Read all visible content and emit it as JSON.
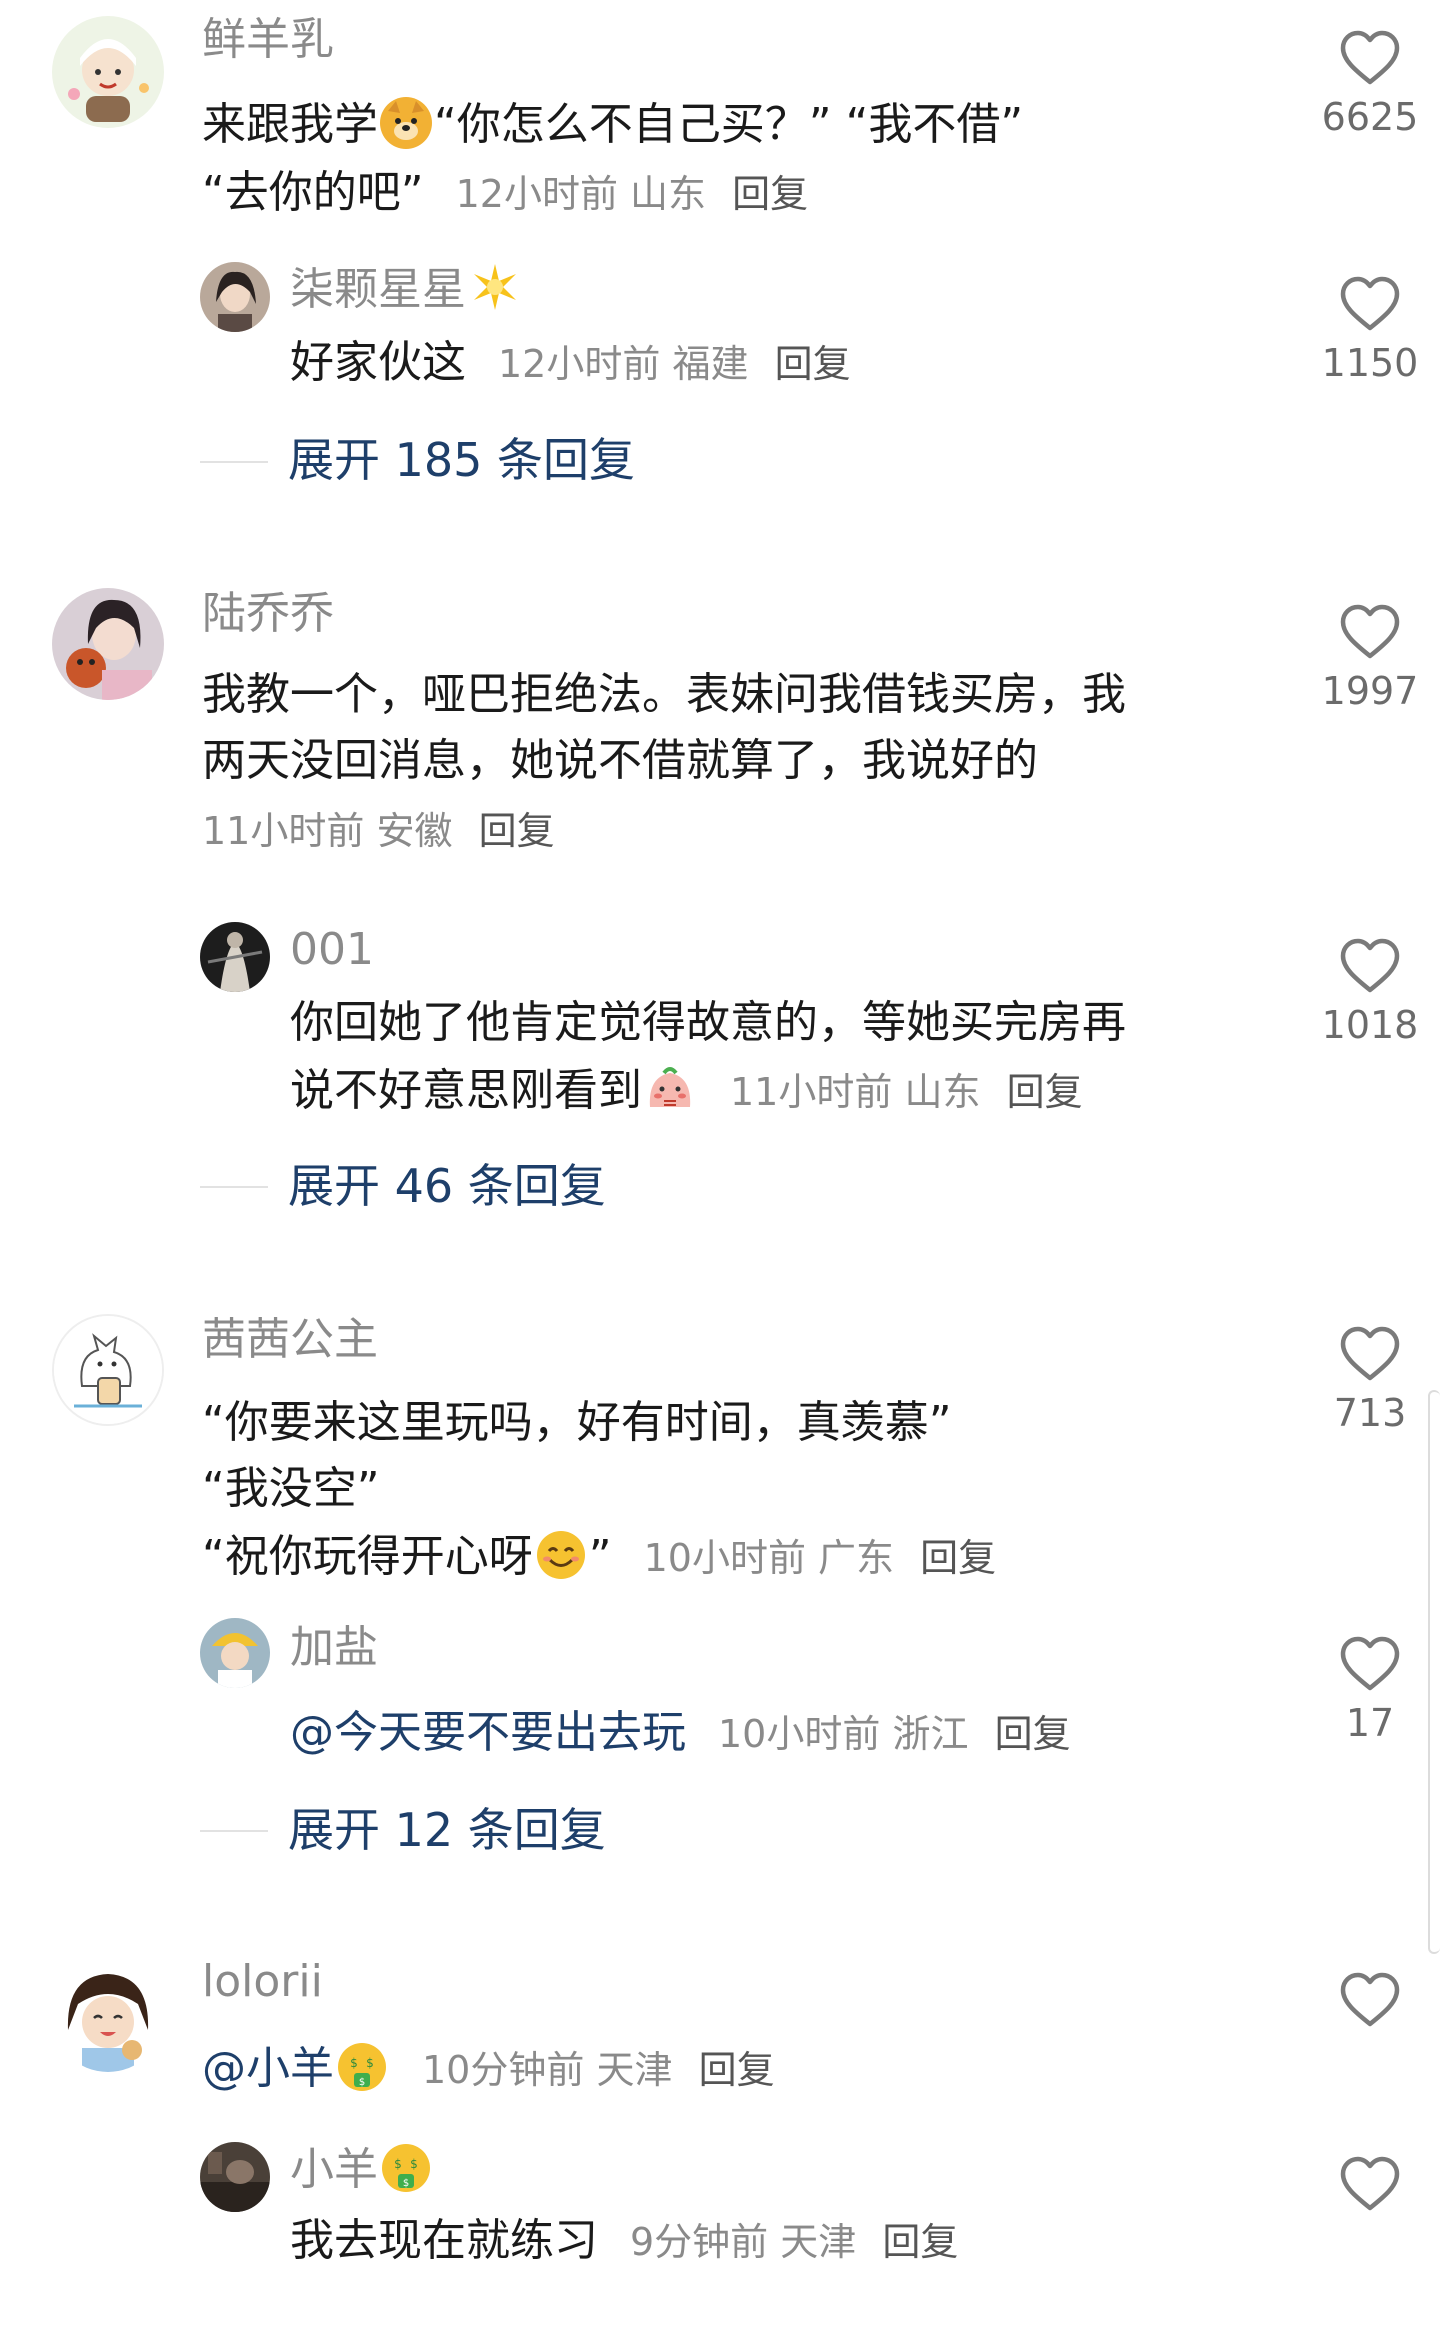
{
  "colors": {
    "mention_blue": "#1e3f6a",
    "meta_gray": "#8a8a8a",
    "heart_gray": "#7a7a7a"
  },
  "comments": [
    {
      "username": "鲜羊乳",
      "text_part1": "来跟我学",
      "text_part2": "“你怎么不自己买？”  “我不借”",
      "text_line2": "“去你的吧”",
      "time": "12小时前",
      "location": "山东",
      "reply": "回复",
      "likes": "6625",
      "emoji": "doge-face-icon",
      "sub": {
        "username": "柒颗星星",
        "username_emoji": "sparkle-star-icon",
        "text": "好家伙这",
        "time": "12小时前",
        "location": "福建",
        "reply": "回复",
        "likes": "1150"
      },
      "expand": "展开 185 条回复"
    },
    {
      "username": "陆乔乔",
      "text_line1": "我教一个，哑巴拒绝法。表妹问我借钱买房，我",
      "text_line2": "两天没回消息，她说不借就算了，我说好的",
      "time": "11小时前",
      "location": "安徽",
      "reply": "回复",
      "likes": "1997",
      "sub": {
        "username": "001",
        "text_line1": "你回她了他肯定觉得故意的，等她买完房再",
        "text_line2": "说不好意思刚看到",
        "emoji": "blushing-bun-icon",
        "time": "11小时前",
        "location": "山东",
        "reply": "回复",
        "likes": "1018"
      },
      "expand": "展开 46 条回复"
    },
    {
      "username": "茜茜公主",
      "text_line1": "“你要来这里玩吗，好有时间，真羡慕”",
      "text_line2": "“我没空”",
      "text_line3": "“祝你玩得开心呀",
      "text_line3_end": "”",
      "emoji": "smiling-face-icon",
      "time": "10小时前",
      "location": "广东",
      "reply": "回复",
      "likes": "713",
      "sub": {
        "username": "加盐",
        "text": "@今天要不要出去玩",
        "time": "10小时前",
        "location": "浙江",
        "reply": "回复",
        "likes": "17"
      },
      "expand": "展开 12 条回复"
    },
    {
      "username": "lolorii",
      "text": "@小羊",
      "emoji": "money-mouth-face-icon",
      "time": "10分钟前",
      "location": "天津",
      "reply": "回复",
      "likes": "",
      "sub": {
        "username": "小羊",
        "username_emoji": "money-mouth-face-icon",
        "text": "我去现在就练习",
        "time": "9分钟前",
        "location": "天津",
        "reply": "回复",
        "likes": ""
      }
    }
  ]
}
